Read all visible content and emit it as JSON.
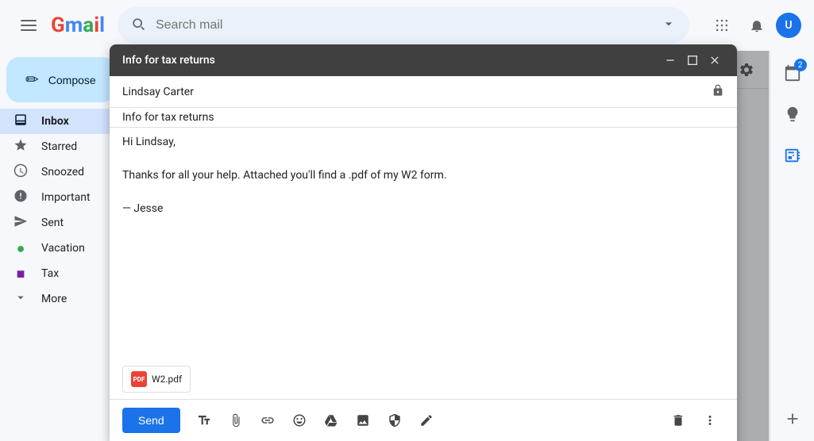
{
  "topbar": {
    "search_placeholder": "Search mail",
    "app_grid_label": "Google apps",
    "notification_label": "Notifications",
    "avatar_initials": "U"
  },
  "sidebar": {
    "compose_label": "Compose",
    "nav_items": [
      {
        "id": "inbox",
        "label": "Inbox",
        "icon": "✉",
        "active": true,
        "count": ""
      },
      {
        "id": "starred",
        "label": "Starred",
        "icon": "☆",
        "active": false,
        "count": ""
      },
      {
        "id": "snoozed",
        "label": "Snoozed",
        "icon": "🕐",
        "active": false,
        "count": ""
      },
      {
        "id": "important",
        "label": "Important",
        "icon": "▶",
        "active": false,
        "count": ""
      },
      {
        "id": "sent",
        "label": "Sent",
        "icon": "➤",
        "active": false,
        "count": ""
      },
      {
        "id": "vacation",
        "label": "Vacation",
        "icon": "●",
        "active": false,
        "count": ""
      },
      {
        "id": "tax",
        "label": "Tax",
        "icon": "■",
        "active": false,
        "count": ""
      },
      {
        "id": "more",
        "label": "More",
        "icon": "˅",
        "active": false,
        "count": ""
      }
    ]
  },
  "compose_modal": {
    "title": "Info for tax returns",
    "to": "Lindsay Carter",
    "subject": "Info for tax returns",
    "body_lines": [
      "Hi Lindsay,",
      "",
      "Thanks for all your help. Attached you'll find a .pdf of my W2 form.",
      "",
      "— Jesse"
    ],
    "attachment": {
      "name": "W2.pdf",
      "icon_text": "PDF"
    },
    "send_label": "Send",
    "minimize_label": "Minimize",
    "maximize_label": "Maximize",
    "close_label": "Close"
  },
  "toolbar": {
    "format_label": "Formatting options",
    "attach_label": "Attach files",
    "link_label": "Insert link",
    "emoji_label": "Insert emoji",
    "drive_label": "Insert files using Drive",
    "photo_label": "Insert photo",
    "lock_label": "Toggle confidential mode",
    "signature_label": "Insert signature",
    "delete_label": "Discard draft",
    "more_label": "More options"
  },
  "right_panel": {
    "calendar_badge": "2",
    "keep_badge": ""
  }
}
